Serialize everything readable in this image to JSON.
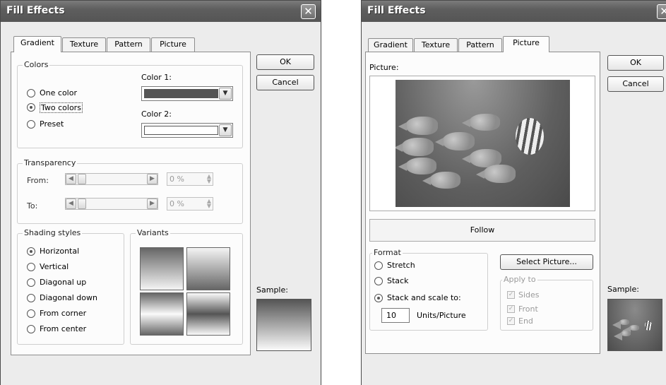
{
  "left_dialog": {
    "title": "Fill Effects",
    "tabs": [
      "Gradient",
      "Texture",
      "Pattern",
      "Picture"
    ],
    "active_tab": "Gradient",
    "ok_label": "OK",
    "cancel_label": "Cancel",
    "colors_group": "Colors",
    "color_options": [
      "One color",
      "Two colors",
      "Preset"
    ],
    "selected_color_option": "Two colors",
    "color1_label": "Color 1:",
    "color1_value": "#555555",
    "color2_label": "Color 2:",
    "color2_value": "#ffffff",
    "transparency_group": "Transparency",
    "from_label": "From:",
    "to_label": "To:",
    "from_value": "0 %",
    "to_value": "0 %",
    "shading_group": "Shading styles",
    "shading_options": [
      "Horizontal",
      "Vertical",
      "Diagonal up",
      "Diagonal down",
      "From corner",
      "From center"
    ],
    "selected_shading": "Horizontal",
    "variants_group": "Variants",
    "sample_label": "Sample:"
  },
  "right_dialog": {
    "title": "Fill Effects",
    "tabs": [
      "Gradient",
      "Texture",
      "Pattern",
      "Picture"
    ],
    "active_tab": "Picture",
    "ok_label": "OK",
    "cancel_label": "Cancel",
    "picture_label": "Picture:",
    "picture_name": "Follow",
    "select_picture_label": "Select Picture...",
    "format_group": "Format",
    "format_options": [
      "Stretch",
      "Stack",
      "Stack and scale to:"
    ],
    "selected_format": "Stack and scale to:",
    "units_value": "10",
    "units_label": "Units/Picture",
    "apply_to_group": "Apply to",
    "apply_to_options": [
      "Sides",
      "Front",
      "End"
    ],
    "sample_label": "Sample:"
  }
}
